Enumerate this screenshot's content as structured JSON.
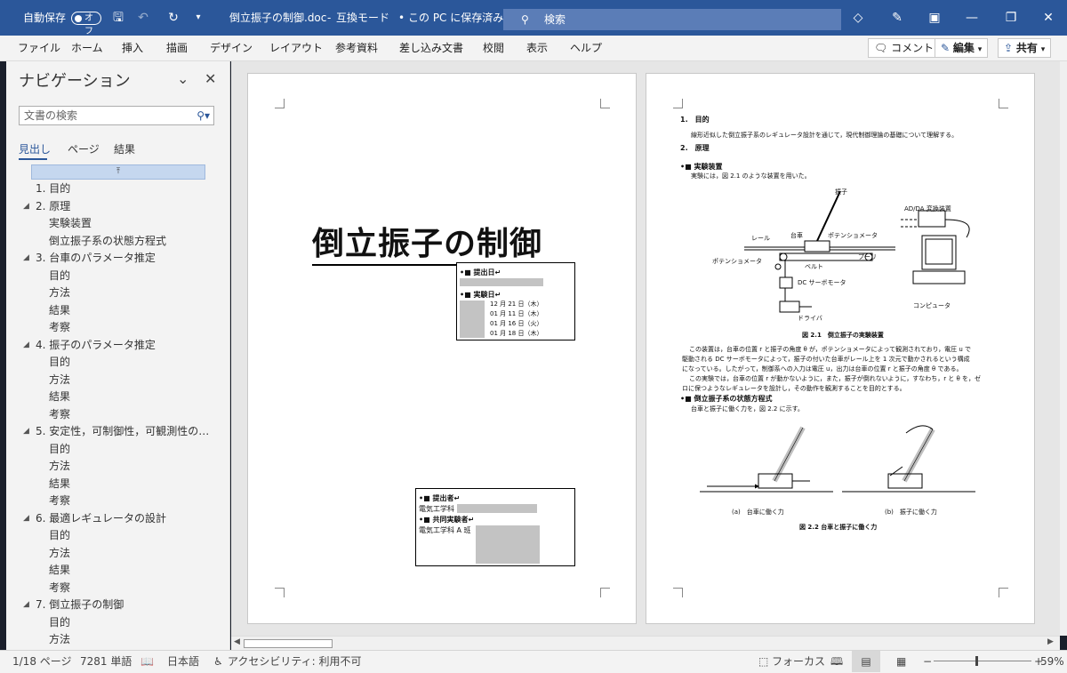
{
  "titlebar": {
    "autosave_label": "自動保存",
    "autosave_state": "オフ",
    "doc_title": "倒立振子の制御.doc",
    "mode": "互換モード",
    "saved_state": "この PC に保存済み",
    "search_placeholder": "検索"
  },
  "ribbon": {
    "tabs": [
      "ファイル",
      "ホーム",
      "挿入",
      "描画",
      "デザイン",
      "レイアウト",
      "参考資料",
      "差し込み文書",
      "校閲",
      "表示",
      "ヘルプ"
    ],
    "comment_label": "コメント",
    "edit_label": "編集",
    "share_label": "共有"
  },
  "nav": {
    "title": "ナビゲーション",
    "search_placeholder": "文書の検索",
    "tabs": [
      "見出し",
      "ページ",
      "結果"
    ],
    "headings": [
      "1. 目的",
      "2. 原理",
      "実験装置",
      "倒立振子系の状態方程式",
      "3. 台車のパラメータ推定",
      "目的",
      "方法",
      "結果",
      "考察",
      "4. 振子のパラメータ推定",
      "目的",
      "方法",
      "結果",
      "考察",
      "5. 安定性，可制御性，可観測性の…",
      "目的",
      "方法",
      "結果",
      "考察",
      "6. 最適レギュレータの設計",
      "目的",
      "方法",
      "結果",
      "考察",
      "7. 倒立振子の制御",
      "目的",
      "方法"
    ]
  },
  "page1": {
    "title": "倒立振子の制御",
    "submit_date_label": "提出日",
    "exp_date_label": "実験日",
    "dates": [
      "12 月 21 日（木）",
      "01 月 11 日（木）",
      "01 月 16 日（火）",
      "01 月 18 日（木）"
    ],
    "submitter_label": "提出者",
    "dept1": "電気工学科",
    "coexp_label": "共同実験者",
    "dept2": "電気工学科 A 班"
  },
  "page2": {
    "h1": "1.　目的",
    "p1": "線形近似した倒立振子系のレギュレータ設計を通じて，現代制御理論の基礎について理解する。",
    "h2": "2.　原理",
    "h2a": "実験装置",
    "p2": "実験には，図 2.1 のような装置を用いた。",
    "fig1": {
      "labels": [
        "振子",
        "レール",
        "台車",
        "ポテンショメータ",
        "AD/DA 変換装置",
        "ポテンショメータ",
        "ベルト",
        "プーリ",
        "DC サーボモータ",
        "ドライバ",
        "コンピュータ"
      ],
      "caption": "図 2.1　倒立振子の実験装置"
    },
    "body_lines": [
      "この装置は，台車の位置 r と振子の角度 θ が，ポテンショメータによって観測されており，電圧 u で",
      "駆動される DC サーボモータによって，振子の付いた台車がレール上を 1 次元で動かされるという構成",
      "になっている。したがって，制御系への入力は電圧 u，出力は台車の位置 r と振子の角度 θ である。",
      "この実験では，台車の位置 r が動かないように，また，振子が倒れないように，すなわち，r と θ を，ゼ",
      "ロに保つようなレギュレータを設計し，その動作を観測することを目的とする。"
    ],
    "h2b": "倒立振子系の状態方程式",
    "p3": "台車と振子に働く力を，図 2.2 に示す。",
    "fig2": {
      "cap_a": "(a)　台車に働く力",
      "cap_b": "(b)　振子に働く力",
      "caption": "図 2.2 台車と振子に働く力"
    }
  },
  "status": {
    "page": "1/18 ページ",
    "words": "7281 単語",
    "language": "日本語",
    "accessibility": "アクセシビリティ: 利用不可",
    "focus": "フォーカス",
    "zoom": "59%"
  },
  "colors": {
    "title_bar": "#2b579a",
    "accent": "#2b579a",
    "ribbon_bg": "#f3f3f3",
    "doc_bg": "#e6e6e6",
    "redacted": "#c3c3c3"
  }
}
